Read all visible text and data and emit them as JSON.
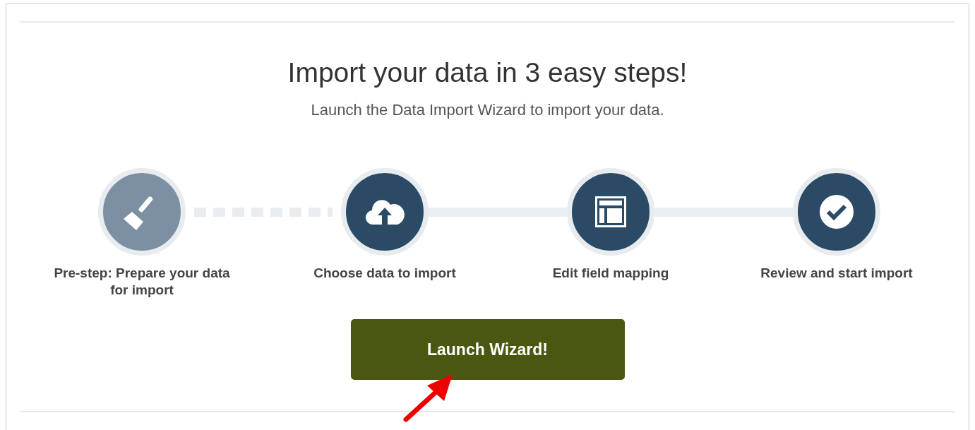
{
  "heading": "Import your data in 3 easy steps!",
  "subheading": "Launch the Data Import Wizard to import your data.",
  "steps": [
    {
      "kind": "pre",
      "label": "Pre-step: Prepare your data for import"
    },
    {
      "kind": "step",
      "label": "Choose data to import"
    },
    {
      "kind": "step",
      "label": "Edit field mapping"
    },
    {
      "kind": "step",
      "label": "Review and start import"
    }
  ],
  "button": {
    "label": "Launch Wizard!"
  }
}
